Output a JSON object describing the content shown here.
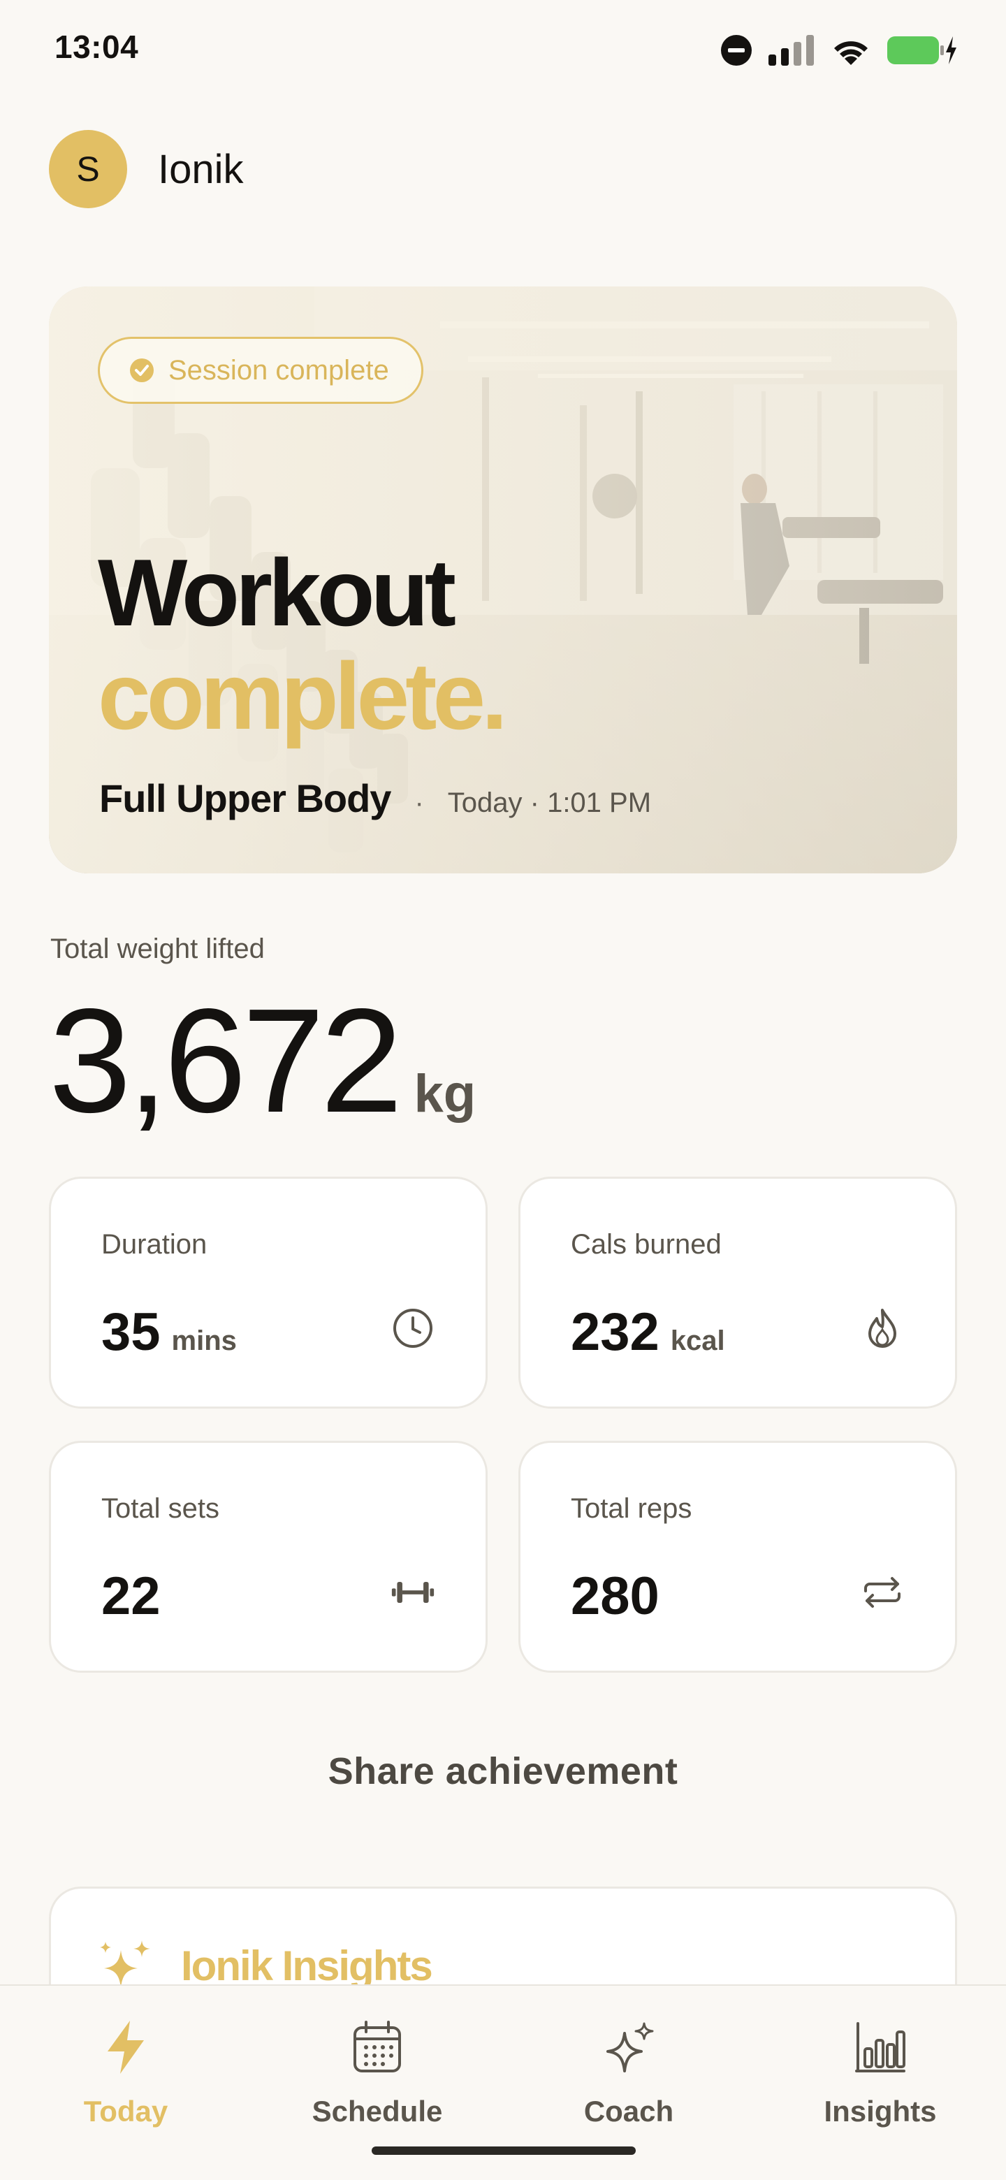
{
  "status_bar": {
    "time": "13:04"
  },
  "header": {
    "avatar_initial": "S",
    "app_name": "Ionik"
  },
  "hero": {
    "badge": "Session complete",
    "title_line1": "Workout",
    "title_line2": "complete.",
    "workout_name": "Full Upper Body",
    "separator": "·",
    "time": "Today · 1:01 PM"
  },
  "total_weight": {
    "label": "Total weight lifted",
    "value": "3,672",
    "unit": "kg"
  },
  "stats": [
    {
      "label": "Duration",
      "value": "35",
      "unit": "mins",
      "icon": "clock-icon"
    },
    {
      "label": "Cals burned",
      "value": "232",
      "unit": "kcal",
      "icon": "flame-icon"
    },
    {
      "label": "Total sets",
      "value": "22",
      "unit": "",
      "icon": "dumbbell-icon"
    },
    {
      "label": "Total reps",
      "value": "280",
      "unit": "",
      "icon": "repeat-icon"
    }
  ],
  "share": {
    "label": "Share achievement"
  },
  "insights": {
    "title": "Ionik Insights",
    "icon": "sparkles-icon"
  },
  "nav": [
    {
      "label": "Today",
      "icon": "bolt-icon",
      "active": true
    },
    {
      "label": "Schedule",
      "icon": "calendar-icon",
      "active": false
    },
    {
      "label": "Coach",
      "icon": "sparkles-icon",
      "active": false
    },
    {
      "label": "Insights",
      "icon": "bar-chart-icon",
      "active": false
    }
  ],
  "colors": {
    "accent": "#e2bf64",
    "background": "#faf8f4",
    "text": "#141210",
    "muted": "#5a554c",
    "battery": "#5dc95a"
  }
}
